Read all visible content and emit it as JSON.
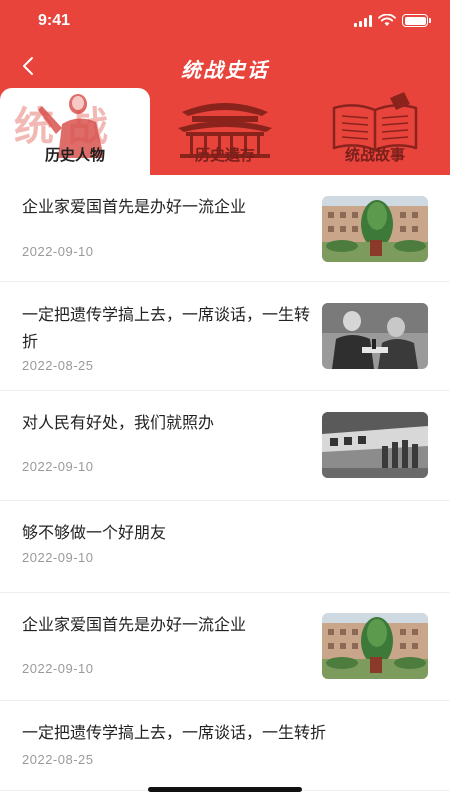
{
  "status_bar": {
    "time": "9:41"
  },
  "nav": {
    "title": "统战史话"
  },
  "tabs": [
    {
      "label": "历史人物",
      "active": true,
      "art_text": "统 战"
    },
    {
      "label": "历史遗存",
      "active": false
    },
    {
      "label": "统战故事",
      "active": false
    }
  ],
  "articles": [
    {
      "title": "企业家爱国首先是办好一流企业",
      "date": "2022-09-10",
      "thumbnail": "building-photo"
    },
    {
      "title": "一定把遗传学搞上去，一席谈话，一生转折",
      "date": "2022-08-25",
      "thumbnail": "scientists-photo"
    },
    {
      "title": "对人民有好处，我们就照办",
      "date": "2022-09-10",
      "thumbnail": "street-photo"
    },
    {
      "title": "够不够做一个好朋友",
      "date": "2022-09-10",
      "thumbnail": ""
    },
    {
      "title": "企业家爱国首先是办好一流企业",
      "date": "2022-09-10",
      "thumbnail": "building-photo"
    },
    {
      "title": "一定把遗传学搞上去，一席谈话，一生转折",
      "date": "2022-08-25",
      "thumbnail": ""
    }
  ],
  "colors": {
    "brand_red": "#e8443c",
    "dark_red": "#7a1f1a",
    "date_gray": "#9a9a9a"
  }
}
